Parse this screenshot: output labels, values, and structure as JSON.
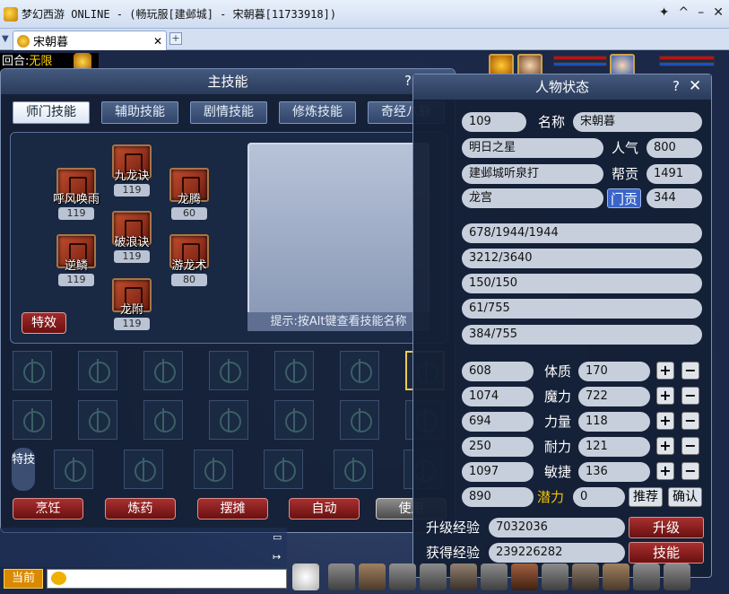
{
  "window": {
    "title": "梦幻西游 ONLINE - (畅玩服[建邺城] - 宋朝暮[11733918])",
    "tab_label": "宋朝暮"
  },
  "hud": {
    "round_label": "回合:",
    "round_value": "无限"
  },
  "skill_panel": {
    "title": "主技能",
    "help": "?",
    "close": "✕",
    "tabs": [
      "师门技能",
      "辅助技能",
      "剧情技能",
      "修炼技能",
      "奇经八脉"
    ],
    "skills": [
      {
        "name": "九龙诀",
        "level": "119"
      },
      {
        "name": "呼风唤雨",
        "level": "119"
      },
      {
        "name": "龙腾",
        "level": "60"
      },
      {
        "name": "破浪诀",
        "level": "119"
      },
      {
        "name": "逆鳞",
        "level": "119"
      },
      {
        "name": "游龙术",
        "level": "80"
      },
      {
        "name": "龙附",
        "level": "119"
      }
    ],
    "special_button": "特效",
    "hint": "提示:按Alt键查看技能名称",
    "teji_label": "特技",
    "bottom_buttons": [
      "烹饪",
      "炼药",
      "摆摊",
      "自动",
      "使用"
    ]
  },
  "char_panel": {
    "title": "人物状态",
    "help": "?",
    "close": "✕",
    "level": "109",
    "name_label": "名称",
    "name_value": "宋朝暮",
    "title_value": "明日之星",
    "popularity_label": "人气",
    "popularity_value": "800",
    "gang_value": "建邺城听泉打",
    "gang_contrib_label": "帮贡",
    "gang_contrib_value": "1491",
    "school_value": "龙宫",
    "school_contrib_label": "门贡",
    "school_contrib_value": "344",
    "hp": "678/1944/1944",
    "mp": "3212/3640",
    "anger": "150/150",
    "vitality": "61/755",
    "energy": "384/755",
    "attributes": [
      {
        "left": "608",
        "label": "体质",
        "value": "170"
      },
      {
        "left": "1074",
        "label": "魔力",
        "value": "722"
      },
      {
        "left": "694",
        "label": "力量",
        "value": "118"
      },
      {
        "left": "250",
        "label": "耐力",
        "value": "121"
      },
      {
        "left": "1097",
        "label": "敏捷",
        "value": "136"
      }
    ],
    "speed_value": "890",
    "potential_label": "潜力",
    "potential_value": "0",
    "recommend_button": "推荐",
    "confirm_button": "确认",
    "upgrade_exp_label": "升级经验",
    "upgrade_exp_value": "7032036",
    "upgrade_button": "升级",
    "earned_exp_label": "获得经验",
    "earned_exp_value": "239226282",
    "skill_button": "技能"
  },
  "chat": {
    "current_button": "当前"
  },
  "colors": {
    "panel_bg": "#14203a",
    "red_button": "#a83030",
    "gold_label": "#f2c300",
    "selected_slot": "#f2c94c"
  }
}
